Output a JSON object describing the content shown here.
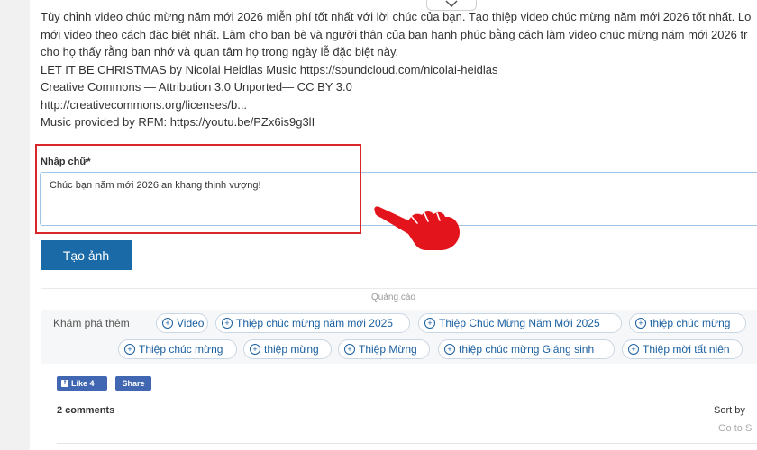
{
  "description": {
    "lines": [
      "Tùy chỉnh video chúc mừng năm mới 2026 miễn phí tốt nhất với lời chúc của bạn. Tạo thiệp video chúc mừng năm mới 2026 tốt nhất. Lo",
      "mới video theo cách đặc biệt nhất. Làm cho bạn bè và người thân của bạn hạnh phúc bằng cách làm video chúc mừng năm mới 2026 tr",
      "cho họ thấy rằng bạn nhớ và quan tâm họ trong ngày lễ đặc biệt này.",
      "LET IT BE CHRISTMAS by Nicolai Heidlas Music https://soundcloud.com/nicolai-heidlas",
      "Creative Commons — Attribution 3.0 Unported— CC BY 3.0",
      "http://creativecommons.org/licenses/b...",
      "Music provided by RFM: https://youtu.be/PZx6is9g3lI"
    ]
  },
  "form": {
    "label": "Nhập chữ*",
    "input_value": "Chúc bạn năm mới 2026 an khang thịnh vượng!",
    "submit_label": "Tạo ảnh"
  },
  "ad": {
    "label": "Quảng cáo"
  },
  "explore": {
    "label": "Khám phá thêm",
    "chips_row1": [
      "Video",
      "Thiệp chúc mừng năm mới 2025",
      "Thiệp Chúc Mừng Năm Mới 2025",
      "thiệp chúc mừng"
    ],
    "chips_row2": [
      "Thiệp chúc mừng",
      "thiệp mừng",
      "Thiệp Mừng",
      "thiệp chúc mừng Giáng sinh",
      "Thiệp mời tất niên"
    ]
  },
  "social": {
    "like_label": "Like 4",
    "share_label": "Share"
  },
  "comments": {
    "count_label": "2 comments",
    "sort_label": "Sort by",
    "goto_label": "Go to S"
  },
  "colors": {
    "accent": "#1a6aa8",
    "highlight": "#d9262b",
    "hand": "#e3141b",
    "facebook": "#4267b2"
  }
}
